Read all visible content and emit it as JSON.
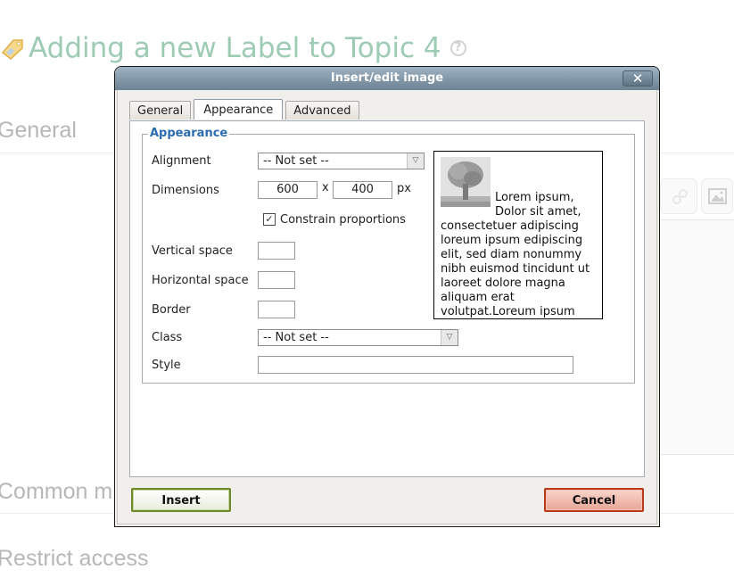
{
  "page": {
    "title": "Adding a new Label to Topic 4",
    "sections": [
      "General",
      "Common m",
      "Restrict access"
    ]
  },
  "dialog": {
    "title": "Insert/edit image",
    "close_label": "✕",
    "tabs": [
      {
        "label": "General",
        "active": false
      },
      {
        "label": "Appearance",
        "active": true
      },
      {
        "label": "Advanced",
        "active": false
      }
    ],
    "fieldset_legend": "Appearance",
    "fields": {
      "alignment": {
        "label": "Alignment",
        "value": "-- Not set --"
      },
      "dimensions": {
        "label": "Dimensions",
        "width": "600",
        "height": "400",
        "separator": "x",
        "unit": "px"
      },
      "constrain": {
        "label": "Constrain proportions",
        "checked": true
      },
      "vertical_space": {
        "label": "Vertical space",
        "value": ""
      },
      "horizontal_space": {
        "label": "Horizontal space",
        "value": ""
      },
      "border": {
        "label": "Border",
        "value": ""
      },
      "class": {
        "label": "Class",
        "value": "-- Not set --"
      },
      "style": {
        "label": "Style",
        "value": ""
      }
    },
    "preview_text": "Lorem ipsum, Dolor sit amet, consectetuer adipiscing loreum ipsum edipiscing elit, sed diam nonummy nibh euismod tincidunt ut laoreet dolore magna aliquam erat volutpat.Loreum ipsum edipiscing elit, sed diam nonummy nibh euismod tincidunt ut laoreet dolore magna aliquam erat volutpat.",
    "buttons": {
      "insert": "Insert",
      "cancel": "Cancel"
    }
  }
}
